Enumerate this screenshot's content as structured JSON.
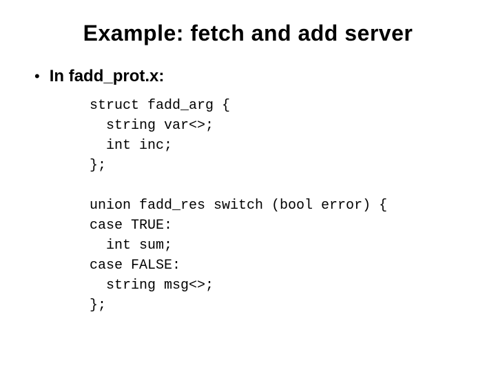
{
  "title": "Example: fetch and add server",
  "bullet": {
    "marker": "•",
    "text": "In fadd_prot.x:"
  },
  "code": "struct fadd_arg {\n  string var<>;\n  int inc;\n};\n\nunion fadd_res switch (bool error) {\ncase TRUE:\n  int sum;\ncase FALSE:\n  string msg<>;\n};"
}
